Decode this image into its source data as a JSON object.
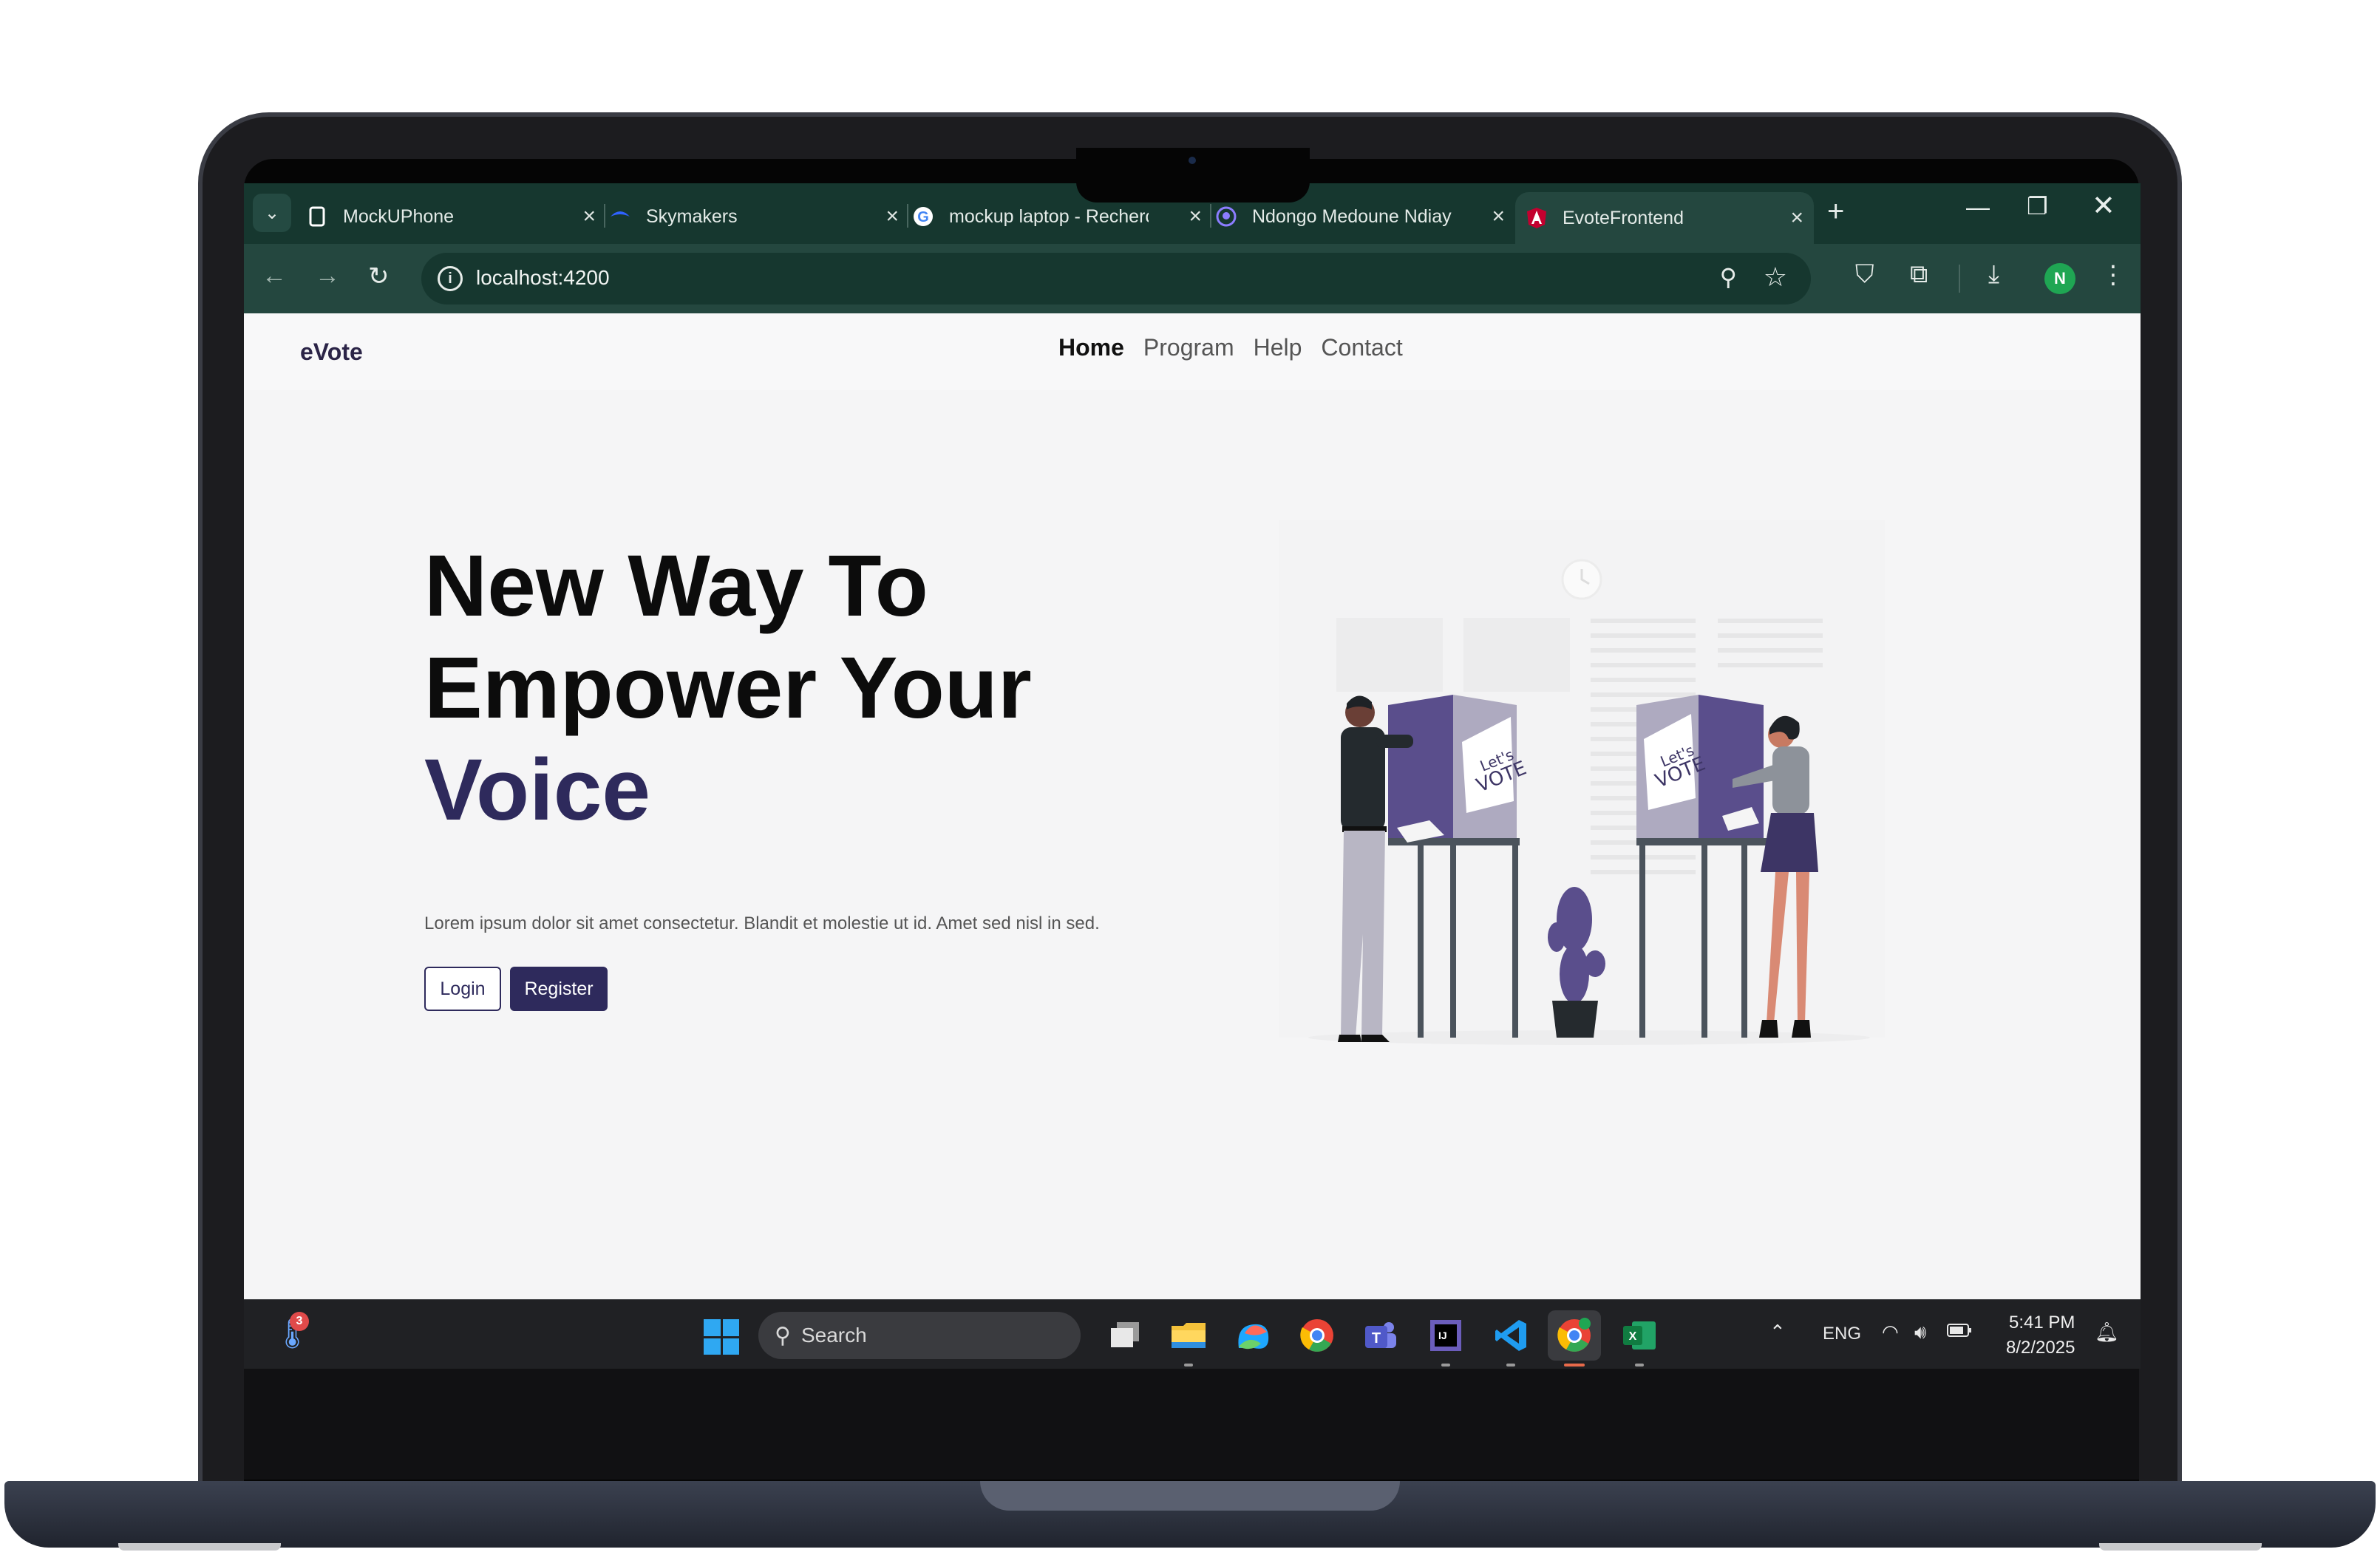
{
  "browser": {
    "tabs": [
      {
        "label": "MockUPhone",
        "icon": "mockuphone-icon"
      },
      {
        "label": "Skymakers",
        "icon": "skymakers-icon"
      },
      {
        "label": "mockup laptop - Recherc",
        "icon": "google-icon"
      },
      {
        "label": "Ndongo Medoune Ndiay",
        "icon": "github-icon"
      },
      {
        "label": "EvoteFrontend",
        "icon": "angular-icon",
        "active": true
      }
    ],
    "url": "localhost:4200",
    "profile_initial": "N"
  },
  "page": {
    "brand": "eVote",
    "nav": [
      "Home",
      "Program",
      "Help",
      "Contact"
    ],
    "hero": {
      "line1": "New Way To",
      "line2": "Empower Your",
      "line3": "Voice",
      "subtitle": "Lorem ipsum dolor sit amet consectetur. Blandit et molestie ut id. Amet sed nisl in sed."
    },
    "buttons": {
      "login": "Login",
      "register": "Register"
    },
    "illustration": {
      "booth_text_line1": "Let's",
      "booth_text_line2": "VOTE"
    },
    "accent_color": "#2e2a5c"
  },
  "taskbar": {
    "weather_badge": "3",
    "search_placeholder": "Search",
    "apps": [
      "file-explorer",
      "m365-copilot",
      "chrome",
      "teams",
      "intellij",
      "vscode",
      "chrome-profile",
      "excel"
    ],
    "language": "ENG",
    "time": "5:41 PM",
    "date": "8/2/2025"
  }
}
